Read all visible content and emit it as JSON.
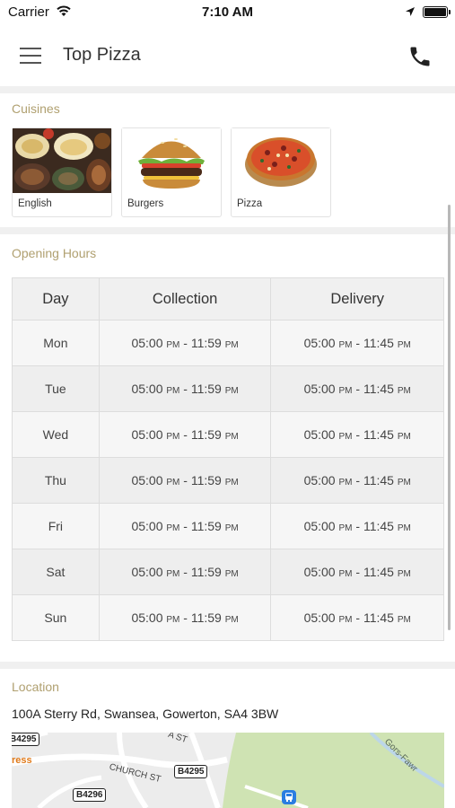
{
  "status_bar": {
    "carrier": "Carrier",
    "time": "7:10 AM"
  },
  "header": {
    "title": "Top Pizza",
    "menu_icon": "hamburger-menu-icon",
    "phone_icon": "phone-icon"
  },
  "cuisines": {
    "title": "Cuisines",
    "items": [
      {
        "label": "English"
      },
      {
        "label": "Burgers"
      },
      {
        "label": "Pizza"
      }
    ]
  },
  "opening_hours": {
    "title": "Opening Hours",
    "columns": [
      "Day",
      "Collection",
      "Delivery"
    ],
    "rows": [
      {
        "day": "Mon",
        "col_open": "05:00",
        "col_open_ampm": "PM",
        "col_close": "11:59",
        "col_close_ampm": "PM",
        "del_open": "05:00",
        "del_open_ampm": "PM",
        "del_close": "11:45",
        "del_close_ampm": "PM"
      },
      {
        "day": "Tue",
        "col_open": "05:00",
        "col_open_ampm": "PM",
        "col_close": "11:59",
        "col_close_ampm": "PM",
        "del_open": "05:00",
        "del_open_ampm": "PM",
        "del_close": "11:45",
        "del_close_ampm": "PM"
      },
      {
        "day": "Wed",
        "col_open": "05:00",
        "col_open_ampm": "PM",
        "col_close": "11:59",
        "col_close_ampm": "PM",
        "del_open": "05:00",
        "del_open_ampm": "PM",
        "del_close": "11:45",
        "del_close_ampm": "PM"
      },
      {
        "day": "Thu",
        "col_open": "05:00",
        "col_open_ampm": "PM",
        "col_close": "11:59",
        "col_close_ampm": "PM",
        "del_open": "05:00",
        "del_open_ampm": "PM",
        "del_close": "11:45",
        "del_close_ampm": "PM"
      },
      {
        "day": "Fri",
        "col_open": "05:00",
        "col_open_ampm": "PM",
        "col_close": "11:59",
        "col_close_ampm": "PM",
        "del_open": "05:00",
        "del_open_ampm": "PM",
        "del_close": "11:45",
        "del_close_ampm": "PM"
      },
      {
        "day": "Sat",
        "col_open": "05:00",
        "col_open_ampm": "PM",
        "col_close": "11:59",
        "col_close_ampm": "PM",
        "del_open": "05:00",
        "del_open_ampm": "PM",
        "del_close": "11:45",
        "del_close_ampm": "PM"
      },
      {
        "day": "Sun",
        "col_open": "05:00",
        "col_open_ampm": "PM",
        "col_close": "11:59",
        "col_close_ampm": "PM",
        "del_open": "05:00",
        "del_open_ampm": "PM",
        "del_close": "11:45",
        "del_close_ampm": "PM"
      }
    ]
  },
  "location": {
    "title": "Location",
    "address": "100A Sterry Rd, Swansea, Gowerton, SA4 3BW",
    "map": {
      "labels": [
        "ress",
        "CHURCH ST",
        "A ST",
        "Gors-Fawr"
      ],
      "badges": [
        "B4295",
        "B4295",
        "B4296"
      ]
    }
  },
  "colors": {
    "section_title": "#b0a070",
    "divider": "#f0f0f0",
    "table_border": "#dddddd",
    "map_green": "#cfe3b3"
  }
}
